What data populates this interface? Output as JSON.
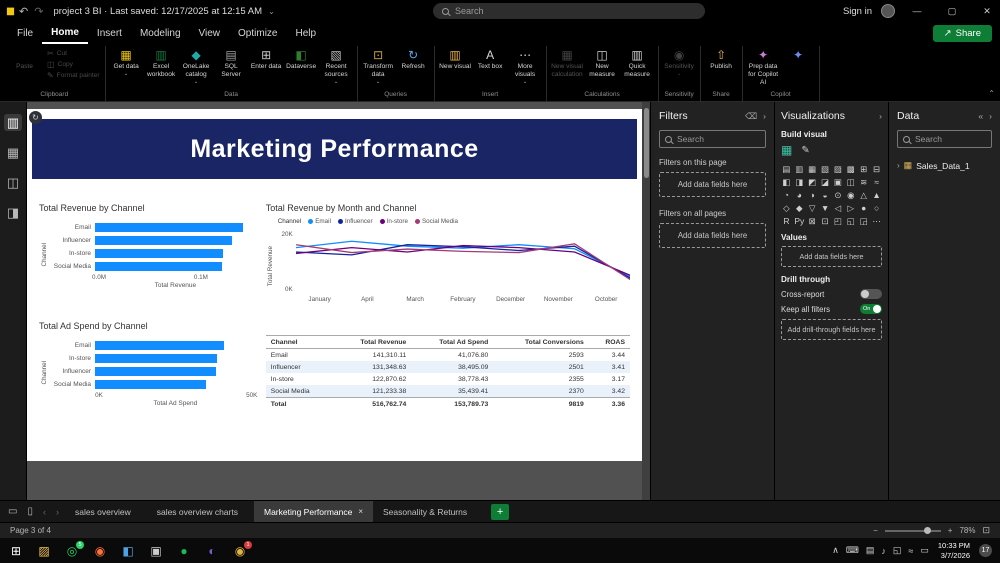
{
  "colors": {
    "accent_blue": "#118DFF",
    "banner_navy": "#1A2565",
    "share_green": "#0E7D35",
    "toggle_on_green": "#0E7D35",
    "tab_add_green": "#0E7D35"
  },
  "titlebar": {
    "logo_icon": "▮▮",
    "undo_icon": "↶",
    "redo_icon": "↷",
    "title": "project 3 BI · Last saved: 12/17/2025 at 12:15 AM",
    "title_caret": "⌄",
    "search_placeholder": "Search",
    "sign_in": "Sign in",
    "minimize_icon": "—",
    "maximize_icon": "▢",
    "close_icon": "✕"
  },
  "menubar": {
    "items": [
      {
        "label": "File"
      },
      {
        "label": "Home",
        "active": true
      },
      {
        "label": "Insert"
      },
      {
        "label": "Modeling"
      },
      {
        "label": "View"
      },
      {
        "label": "Optimize"
      },
      {
        "label": "Help"
      }
    ],
    "share_icon": "↗",
    "share_label": "Share"
  },
  "ribbon": {
    "clipboard_title": "Clipboard",
    "paste": "Paste",
    "paste_icon": "▤",
    "cut": "Cut",
    "cut_icon": "✂",
    "copy": "Copy",
    "copy_icon": "◫",
    "format_painter": "Format painter",
    "format_painter_icon": "✎",
    "data_title": "Data",
    "data_items": [
      {
        "label": "Get data",
        "glyph": "▦",
        "color": "#F2C811",
        "caret": "⌄"
      },
      {
        "label": "Excel workbook",
        "glyph": "▥",
        "color": "#107C41"
      },
      {
        "label": "OneLake catalog",
        "glyph": "◆",
        "color": "#1FA8A8",
        "caret": "⌄"
      },
      {
        "label": "SQL Server",
        "glyph": "▤",
        "color": "#A0A0A0"
      },
      {
        "label": "Enter data",
        "glyph": "⊞",
        "color": "#C8C8C8"
      },
      {
        "label": "Dataverse",
        "glyph": "◧",
        "color": "#2E7D32"
      },
      {
        "label": "Recent sources",
        "glyph": "▧",
        "color": "#BDBDBD",
        "caret": "⌄"
      }
    ],
    "queries_title": "Queries",
    "queries_items": [
      {
        "label": "Transform data",
        "glyph": "⊡",
        "color": "#C9A63C",
        "caret": "⌄"
      },
      {
        "label": "Refresh",
        "glyph": "↻",
        "color": "#59A7E8"
      }
    ],
    "insert_title": "Insert",
    "insert_items": [
      {
        "label": "New visual",
        "glyph": "▥",
        "color": "#E8B64C"
      },
      {
        "label": "Text box",
        "glyph": "A",
        "color": "#D6D6D6"
      },
      {
        "label": "More visuals",
        "glyph": "⋯",
        "color": "#D6D6D6",
        "caret": "⌄"
      }
    ],
    "calculations_title": "Calculations",
    "calculations_items": [
      {
        "label": "New visual calculation",
        "glyph": "▦",
        "color": "#AAAAAA",
        "disabled": true
      },
      {
        "label": "New measure",
        "glyph": "◫",
        "color": "#D6D6D6"
      },
      {
        "label": "Quick measure",
        "glyph": "▥",
        "color": "#D6D6D6"
      }
    ],
    "sensitivity_title": "Sensitivity",
    "sensitivity_items": [
      {
        "label": "Sensitivity",
        "glyph": "◉",
        "color": "#AAAAAA",
        "disabled": true,
        "caret": "⌄"
      }
    ],
    "share_title": "Share",
    "share_items": [
      {
        "label": "Publish",
        "glyph": "⇧",
        "color": "#E8B64C"
      }
    ],
    "copilot_title": "Copilot",
    "copilot_items": [
      {
        "label": "Prep data for Copilot AI",
        "glyph": "✦",
        "color": "#C97BD8"
      },
      {
        "label": "",
        "glyph": "✦",
        "color": "#6E8BF7"
      }
    ],
    "collapse": "⌃"
  },
  "left_rail": {
    "items": [
      {
        "glyph": "▥",
        "active": true
      },
      {
        "glyph": "▦"
      },
      {
        "glyph": "◫"
      },
      {
        "glyph": "◨"
      }
    ]
  },
  "report": {
    "title": "Marketing Performance",
    "corner_icon": "↻"
  },
  "chart_data": [
    {
      "type": "bar",
      "title": "Total Revenue by Channel",
      "categories": [
        "Email",
        "Influencer",
        "In-store",
        "Social Media"
      ],
      "values": [
        141310,
        131349,
        122871,
        121233
      ],
      "xlabel": "Total Revenue",
      "ylabel": "Channel",
      "xmax": 150000,
      "xticks": [
        {
          "label": "0.0M",
          "frac": 0
        },
        {
          "label": "0.1M",
          "frac": 0.667
        }
      ],
      "bar_color": "#118DFF"
    },
    {
      "type": "line",
      "title": "Total Revenue by Month and Channel",
      "legend_title": "Channel",
      "x": [
        "January",
        "April",
        "March",
        "February",
        "December",
        "November",
        "October"
      ],
      "series": [
        {
          "name": "Email",
          "color": "#118DFF",
          "values": [
            15600,
            17800,
            16100,
            15400,
            16600,
            15200,
            5600
          ]
        },
        {
          "name": "Influencer",
          "color": "#12239E",
          "values": [
            14100,
            13100,
            16600,
            15900,
            14600,
            16100,
            5100
          ]
        },
        {
          "name": "In-store",
          "color": "#6B007B",
          "values": [
            13600,
            15600,
            14100,
            16300,
            15600,
            14100,
            6100
          ]
        },
        {
          "name": "Social Media",
          "color": "#A43B76",
          "values": [
            16600,
            13900,
            15100,
            14300,
            13900,
            16900,
            4600
          ]
        }
      ],
      "ylabel": "Total Revenue",
      "ymax": 22000,
      "yticks": [
        "20K",
        "0K"
      ]
    },
    {
      "type": "bar",
      "title": "Total Ad Spend by Channel",
      "categories": [
        "Email",
        "In-store",
        "Influencer",
        "Social Media"
      ],
      "values": [
        41077,
        38778,
        38495,
        35439
      ],
      "xlabel": "Total Ad Spend",
      "ylabel": "Channel",
      "xmax": 50000,
      "xticks": [
        {
          "label": "0K",
          "frac": 0
        },
        {
          "label": "50K",
          "frac": 1
        }
      ],
      "bar_color": "#118DFF"
    },
    {
      "type": "table",
      "headers": [
        "Channel",
        "Total Revenue",
        "Total Ad Spend",
        "Total Conversions",
        "ROAS"
      ],
      "rows": [
        [
          "Email",
          "141,310.11",
          "41,076.80",
          "2593",
          "3.44"
        ],
        [
          "Influencer",
          "131,348.63",
          "38,495.09",
          "2501",
          "3.41"
        ],
        [
          "In-store",
          "122,870.62",
          "38,778.43",
          "2355",
          "3.17"
        ],
        [
          "Social Media",
          "121,233.38",
          "35,439.41",
          "2370",
          "3.42"
        ],
        [
          "Total",
          "516,762.74",
          "153,789.73",
          "9819",
          "3.36"
        ]
      ]
    }
  ],
  "filters": {
    "title": "Filters",
    "eraser_icon": "⌫",
    "collapse_icon": "›",
    "search_placeholder": "Search",
    "section_page": "Filters on this page",
    "section_all": "Filters on all pages",
    "add_fields_page": "Add data fields here",
    "add_fields_all": "Add data fields here"
  },
  "visualizations": {
    "title": "Visualizations",
    "collapse_icon": "›",
    "build_visual": "Build visual",
    "current_visual_icon": "▦",
    "format_icon": "✎",
    "visual_icons": [
      "▤",
      "▥",
      "▦",
      "▧",
      "▨",
      "▩",
      "⊞",
      "⊟",
      "◧",
      "◨",
      "◩",
      "◪",
      "▣",
      "◫",
      "≋",
      "≈",
      "◔",
      "◕",
      "◑",
      "◒",
      "⊙",
      "◉",
      "△",
      "▲",
      "◇",
      "◆",
      "▽",
      "▼",
      "◁",
      "▷",
      "●",
      "○",
      "R",
      "Py",
      "⊠",
      "⊡",
      "◰",
      "◱",
      "◲",
      "⋯"
    ],
    "values_label": "Values",
    "add_values": "Add data fields here",
    "drill_through": "Drill through",
    "cross_report": "Cross-report",
    "keep_filters": "Keep all filters",
    "toggle_on_label": "On",
    "add_drill": "Add drill-through fields here"
  },
  "data_panel": {
    "title": "Data",
    "collapse_icon": "«",
    "chevron": "›",
    "search_placeholder": "Search",
    "table_chevron": "›",
    "table_icon": "▦",
    "table_name": "Sales_Data_1"
  },
  "pages": {
    "desktop_icon": "▭",
    "phone_icon": "▯",
    "prev": "‹",
    "next": "›",
    "tabs": [
      {
        "label": "sales overview"
      },
      {
        "label": "sales overview charts"
      },
      {
        "label": "Marketing Performance",
        "active": true,
        "close": "×"
      },
      {
        "label": "Seasonality & Returns"
      }
    ],
    "add_page": "+"
  },
  "statusbar": {
    "page_indicator": "Page 3 of 4",
    "zoom_out": "−",
    "zoom_in": "+",
    "zoom": "78%",
    "fit_icon": "⊡"
  },
  "taskbar": {
    "icons": [
      {
        "name": "start",
        "glyph": "⊞",
        "color": "#FFFFFF"
      },
      {
        "name": "folder",
        "glyph": "▨",
        "color": "#F6C453"
      },
      {
        "name": "whatsapp",
        "glyph": "◎",
        "color": "#25D366",
        "badge": "5",
        "badge_color": "#25D366"
      },
      {
        "name": "firefox",
        "glyph": "◉",
        "color": "#FF7139"
      },
      {
        "name": "vscode",
        "glyph": "◧",
        "color": "#4FA3E3"
      },
      {
        "name": "terminal",
        "glyph": "▣",
        "color": "#CCCCCC"
      },
      {
        "name": "spotify",
        "glyph": "●",
        "color": "#1DB954"
      },
      {
        "name": "eclipse",
        "glyph": "◐",
        "color": "#7B5CD6"
      },
      {
        "name": "people",
        "glyph": "◉",
        "color": "#E3B341",
        "badge": "1",
        "badge_color": "#D83B3B"
      }
    ],
    "tray": [
      {
        "glyph": "∧"
      },
      {
        "glyph": "⌨"
      },
      {
        "glyph": "▤"
      },
      {
        "glyph": "♪"
      },
      {
        "glyph": "◱"
      },
      {
        "glyph": "≈"
      },
      {
        "glyph": "▭"
      }
    ],
    "time": "10:33 PM",
    "date": "3/7/2026",
    "badge": "17"
  }
}
